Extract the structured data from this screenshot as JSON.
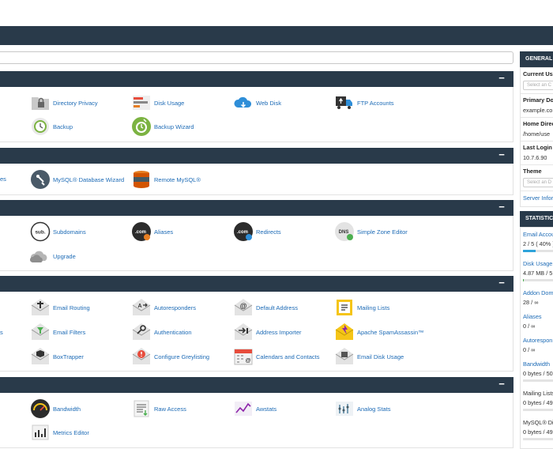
{
  "colors": {
    "nav": "#293a4a",
    "link": "#1d6bb6",
    "bar_blue": "#2ea3da",
    "bar_green": "#4caf50"
  },
  "panel_collapse_symbol": "−",
  "files": {
    "items": [
      {
        "label": "Directory Privacy",
        "icon": "folder-lock-icon"
      },
      {
        "label": "Disk Usage",
        "icon": "disk-usage-icon"
      },
      {
        "label": "Web Disk",
        "icon": "cloud-icon"
      },
      {
        "label": "FTP Accounts",
        "icon": "ftp-truck-icon"
      },
      {
        "label": "Backup",
        "icon": "backup-clock-icon"
      },
      {
        "label": "Backup Wizard",
        "icon": "backup-wizard-icon"
      }
    ]
  },
  "databases": {
    "left_stub": "es",
    "items": [
      {
        "label": "MySQL® Database Wizard",
        "icon": "db-wizard-icon"
      },
      {
        "label": "Remote MySQL®",
        "icon": "remote-db-icon"
      }
    ]
  },
  "domains": {
    "items": [
      {
        "label": "Subdomains",
        "icon": "subdomain-icon",
        "glyph": "sub."
      },
      {
        "label": "Aliases",
        "icon": "aliases-icon",
        "glyph": ".com"
      },
      {
        "label": "Redirects",
        "icon": "redirects-icon",
        "glyph": ".com"
      },
      {
        "label": "Simple Zone Editor",
        "icon": "dns-icon",
        "glyph": "DNS"
      },
      {
        "label": "Upgrade",
        "icon": "upgrade-cloud-icon"
      }
    ]
  },
  "email": {
    "left_stub": "s",
    "items": [
      {
        "label": "Email Routing",
        "icon": "email-routing-icon"
      },
      {
        "label": "Autoresponders",
        "icon": "autoresponder-icon"
      },
      {
        "label": "Default Address",
        "icon": "default-address-icon"
      },
      {
        "label": "Mailing Lists",
        "icon": "mailing-lists-icon"
      },
      {
        "label": "Email Filters",
        "icon": "email-filters-icon"
      },
      {
        "label": "Authentication",
        "icon": "authentication-icon"
      },
      {
        "label": "Address Importer",
        "icon": "address-importer-icon"
      },
      {
        "label": "Apache SpamAssassin™",
        "icon": "spamassassin-icon"
      },
      {
        "label": "BoxTrapper",
        "icon": "boxtrapper-icon"
      },
      {
        "label": "Configure Greylisting",
        "icon": "greylisting-icon"
      },
      {
        "label": "Calendars and Contacts",
        "icon": "calendar-icon"
      },
      {
        "label": "Email Disk Usage",
        "icon": "email-disk-icon"
      }
    ]
  },
  "metrics": {
    "items": [
      {
        "label": "Bandwidth",
        "icon": "bandwidth-gauge-icon"
      },
      {
        "label": "Raw Access",
        "icon": "raw-access-icon"
      },
      {
        "label": "Awstats",
        "icon": "awstats-icon"
      },
      {
        "label": "Analog Stats",
        "icon": "analog-stats-icon"
      },
      {
        "label": "Metrics Editor",
        "icon": "metrics-editor-icon"
      }
    ]
  },
  "sidebar": {
    "general_title": "GENERAL",
    "current_user_label": "Current Us",
    "current_user_placeholder": "Select an C",
    "primary_domain_label": "Primary Do",
    "primary_domain_value": "example.co",
    "home_dir_label": "Home Direc",
    "home_dir_value": "/home/use",
    "last_login_label": "Last Login",
    "last_login_value": "10.7.6.90",
    "theme_label": "Theme",
    "theme_placeholder": "Select an D",
    "server_info_link": "Server Infor",
    "statistics_title": "STATISTICS",
    "stats": [
      {
        "label": "Email Accou",
        "value": "2 / 5 ( 40% )",
        "fill": 0.4,
        "bar": "blue"
      },
      {
        "label": "Disk Usage",
        "value": "4.87 MB / 5",
        "fill": 0.03,
        "bar": "green"
      },
      {
        "label": "Addon Dom",
        "value": "28 / ∞",
        "fill": 0,
        "bar": "none"
      },
      {
        "label": "Aliases",
        "value": "0 / ∞",
        "fill": 0,
        "bar": "none"
      },
      {
        "label": "Autorespon",
        "value": "0 / ∞",
        "fill": 0,
        "bar": "none"
      },
      {
        "label": "Bandwidth",
        "value": "0 bytes / 50",
        "fill": 0,
        "bar": "grey"
      },
      {
        "label": "Mailing Lists",
        "value": "0 bytes / 49",
        "fill": 0,
        "bar": "grey"
      },
      {
        "label": "MySQL® Di",
        "value": "0 bytes / 49",
        "fill": 0,
        "bar": "grey"
      }
    ]
  }
}
